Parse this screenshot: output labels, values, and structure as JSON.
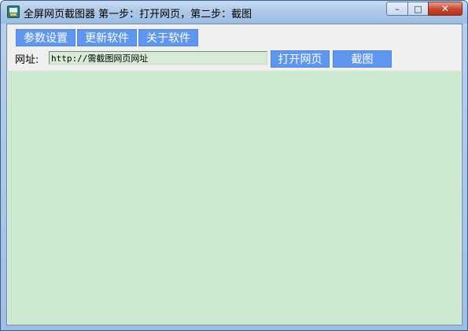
{
  "window": {
    "title": "全屏网页截图器 第一步：打开网页，第二步：截图",
    "icon": "app-screenshot-icon",
    "controls": {
      "minimize": "–",
      "maximize": "□",
      "close": "✕"
    }
  },
  "toolbar": {
    "settings_label": "参数设置",
    "update_label": "更新软件",
    "about_label": "关于软件"
  },
  "address": {
    "label": "网址:",
    "value": "http://需截图网页网址",
    "open_label": "打开网页",
    "capture_label": "截图"
  },
  "colors": {
    "button": "#5f97f0",
    "browser_area": "#cce8cf",
    "url_field": "#d6ecd6"
  }
}
